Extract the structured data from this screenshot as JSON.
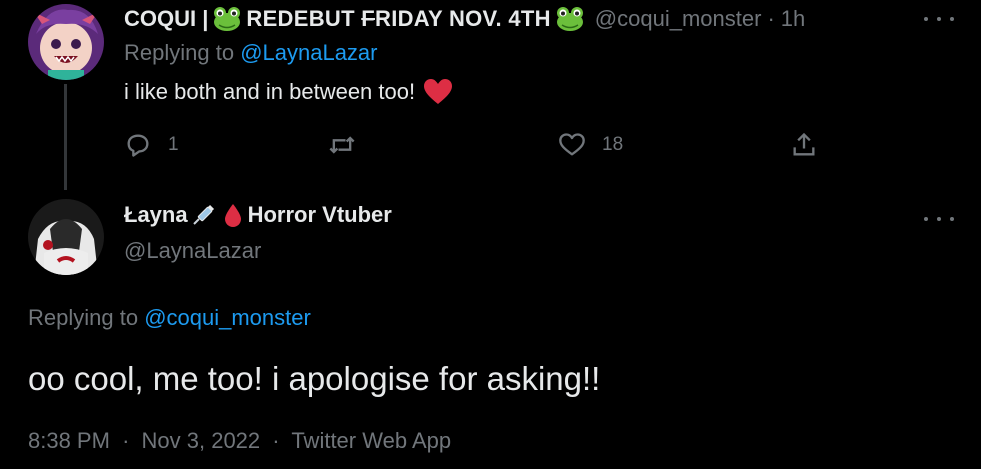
{
  "tweet1": {
    "display_name_prefix": "COQUI |",
    "display_name_event": "REDEBUT FRIDAY NOV. 4TH",
    "handle": "@coqui_monster",
    "time_separator": "·",
    "time": "1h",
    "replying_prefix": "Replying to",
    "replying_to": "@LaynaLazar",
    "text": "i like both and in between too!",
    "actions": {
      "replies": "1",
      "likes": "18"
    }
  },
  "tweet2": {
    "display_name": "Łayna",
    "display_name_suffix": "Horror Vtuber",
    "handle": "@LaynaLazar",
    "replying_prefix": "Replying to",
    "replying_to": "@coqui_monster",
    "text": "oo cool, me too! i apologise for asking!!",
    "time": "8:38 PM",
    "date": "Nov 3, 2022",
    "source": "Twitter Web App",
    "separator": "·"
  },
  "colors": {
    "background": "#000000",
    "text_primary": "#e7e9ea",
    "text_secondary": "#71767b",
    "link": "#1d9bf0",
    "thread_line": "#333639"
  },
  "icons": [
    "reply-icon",
    "retweet-icon",
    "like-icon",
    "share-icon",
    "more-icon",
    "frog-emoji",
    "heart-emoji",
    "syringe-emoji",
    "blood-drop-emoji"
  ]
}
